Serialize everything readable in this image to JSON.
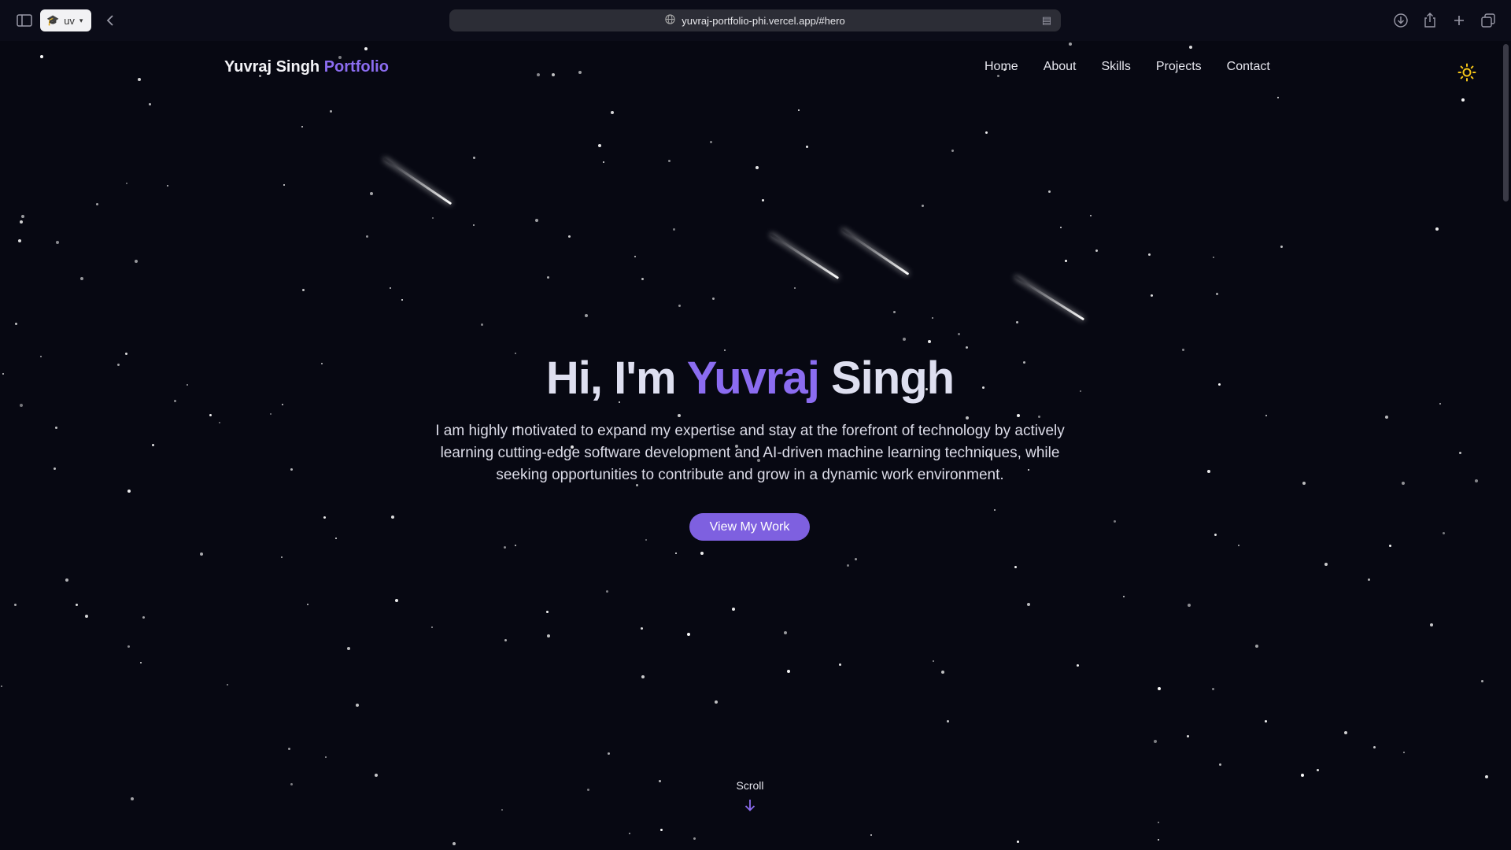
{
  "browser": {
    "profile_label": "uv",
    "url": "yuvraj-portfolio-phi.vercel.app/#hero"
  },
  "site": {
    "logo_name": "Yuvraj Singh",
    "logo_accent": "Portfolio",
    "nav": [
      "Home",
      "About",
      "Skills",
      "Projects",
      "Contact"
    ]
  },
  "hero": {
    "title_prefix": "Hi, I'm",
    "title_accent": "Yuvraj",
    "title_suffix": "Singh",
    "description": "I am highly motivated to expand my expertise and stay at the forefront of technology by actively learning cutting-edge software development and AI-driven machine learning techniques, while seeking opportunities to contribute and grow in a dynamic work environment.",
    "cta_label": "View My Work",
    "scroll_label": "Scroll"
  },
  "colors": {
    "background": "#070812",
    "accent": "#8b6cf0",
    "button": "#7e60e0",
    "theme_icon": "#f5c518"
  },
  "icons": {
    "sidebar": "sidebar-toggle-icon",
    "back": "chevron-left-icon",
    "download": "download-icon",
    "share": "share-icon",
    "new_tab": "plus-icon",
    "tabs": "tabs-overview-icon",
    "theme": "sun-icon",
    "scroll": "arrow-down-icon"
  }
}
